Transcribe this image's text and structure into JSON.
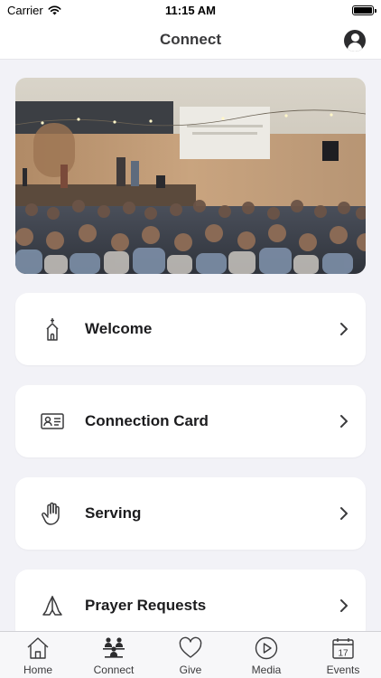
{
  "status_bar": {
    "carrier": "Carrier",
    "time": "11:15 AM"
  },
  "header": {
    "title": "Connect",
    "profile_icon": "person-circle-icon"
  },
  "hero": {
    "image": "church-congregation-worship-photo"
  },
  "menu": [
    {
      "label": "Welcome",
      "icon": "church-icon"
    },
    {
      "label": "Connection Card",
      "icon": "id-card-icon"
    },
    {
      "label": "Serving",
      "icon": "raised-hand-icon"
    },
    {
      "label": "Prayer Requests",
      "icon": "praying-hands-icon"
    }
  ],
  "tabs": [
    {
      "label": "Home",
      "icon": "home-icon"
    },
    {
      "label": "Connect",
      "icon": "people-icon",
      "selected": true
    },
    {
      "label": "Give",
      "icon": "heart-icon"
    },
    {
      "label": "Media",
      "icon": "play-icon"
    },
    {
      "label": "Events",
      "icon": "calendar-icon",
      "calendar_day": "17"
    }
  ],
  "colors": {
    "background": "#f2f2f7",
    "card": "#ffffff",
    "text": "#1c1c1e",
    "icon": "#3a3a3c"
  }
}
